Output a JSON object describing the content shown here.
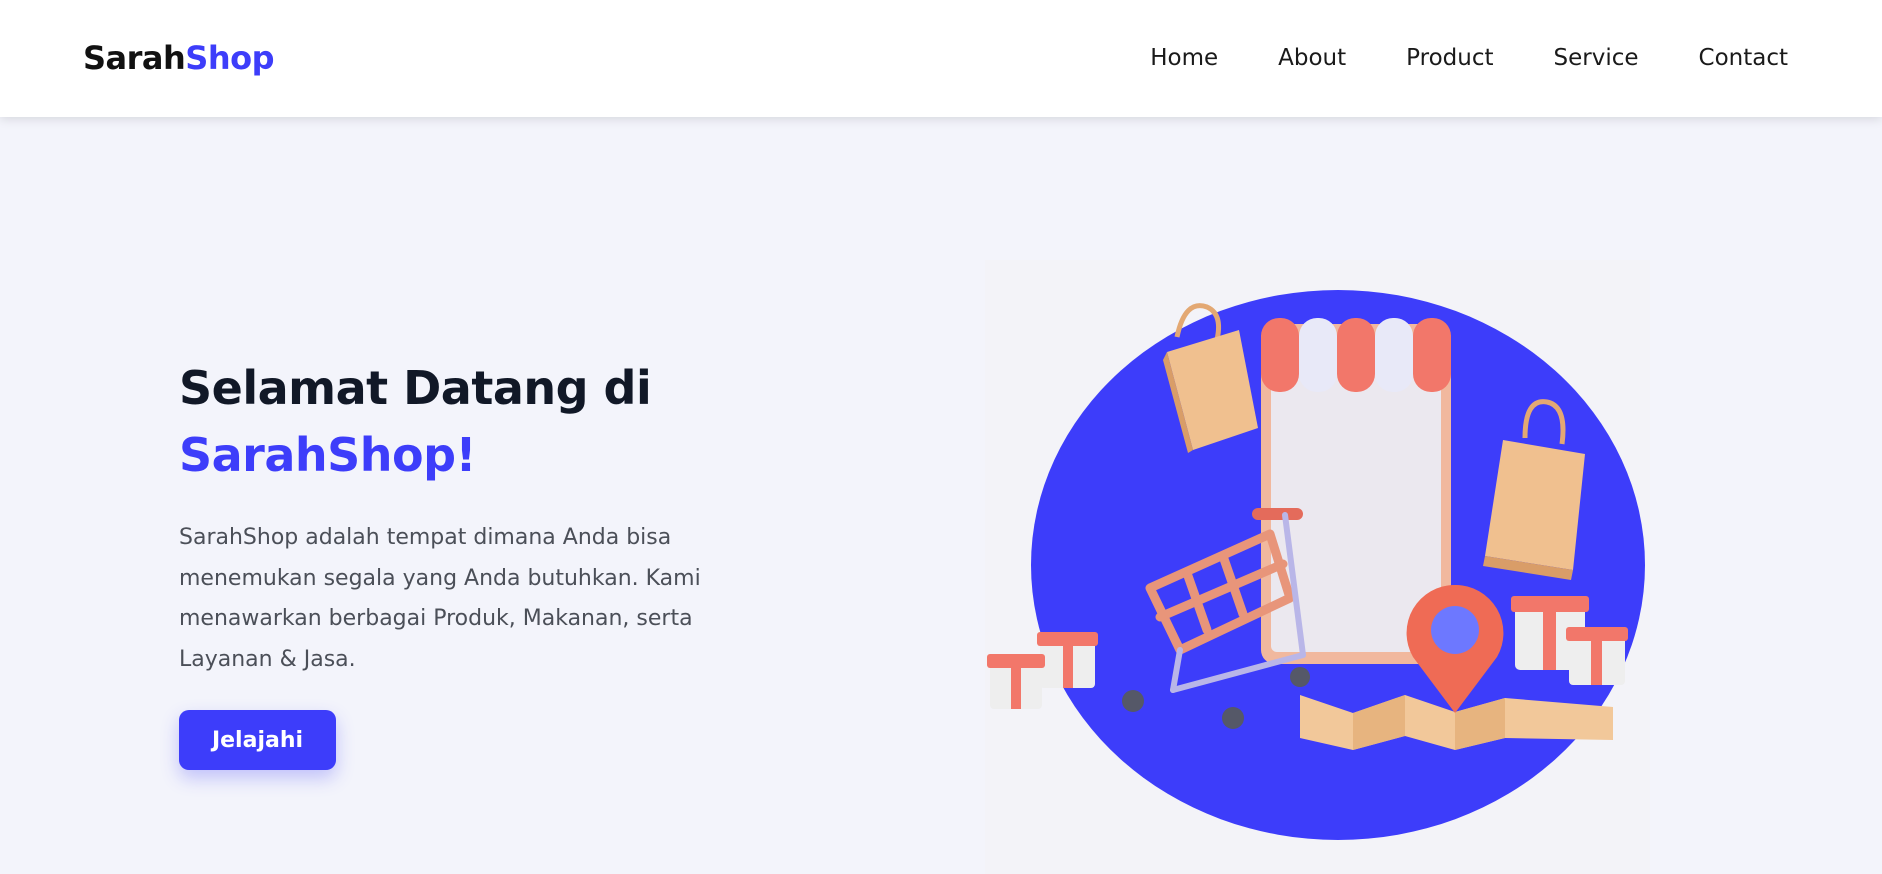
{
  "header": {
    "logo_part1": "Sarah",
    "logo_part2": "Shop",
    "nav": [
      {
        "label": "Home"
      },
      {
        "label": "About"
      },
      {
        "label": "Product"
      },
      {
        "label": "Service"
      },
      {
        "label": "Contact"
      }
    ]
  },
  "hero": {
    "title_line1": "Selamat Datang di",
    "title_line2": "SarahShop!",
    "description": "SarahShop adalah tempat dimana Anda bisa menemukan segala yang Anda butuhkan. Kami menawarkan berbagai Produk, Makanan, serta Layanan & Jasa.",
    "cta_label": "Jelajahi"
  },
  "colors": {
    "brand": "#3d3dfa",
    "page_background": "#f3f4fb",
    "heading": "#111827",
    "body_text": "#4b4f58",
    "illustration_circle": "#3d3dfa",
    "awning_red": "#f2776a",
    "bag_tan": "#f0c08f"
  },
  "icons": {
    "hero_illustration": "online-shop-illustration",
    "shopping_cart": "shopping-cart-icon",
    "shopping_bag": "shopping-bag-icon",
    "location_pin": "location-pin-icon",
    "gift_box": "gift-box-icon",
    "map": "folded-map-icon",
    "store_phone": "storefront-phone-icon"
  }
}
